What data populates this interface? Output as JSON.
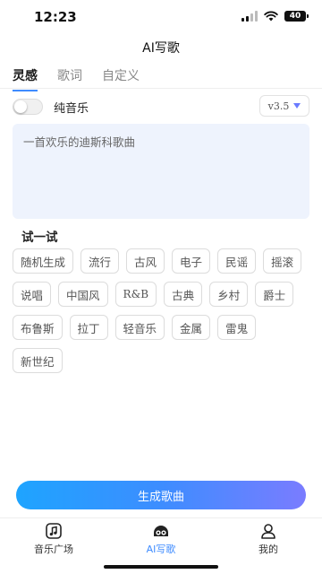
{
  "status": {
    "time": "12:23",
    "battery": "40",
    "icons": [
      "signal-icon",
      "wifi-icon",
      "battery-icon"
    ]
  },
  "header": {
    "title": "AI写歌"
  },
  "tabs": [
    {
      "label": "灵感",
      "active": true
    },
    {
      "label": "歌词",
      "active": false
    },
    {
      "label": "自定义",
      "active": false
    }
  ],
  "options": {
    "pure_music_label": "纯音乐",
    "pure_music_on": false,
    "version": "v3.5"
  },
  "prompt": {
    "placeholder": "一首欢乐的迪斯科歌曲",
    "value": ""
  },
  "suggestions": {
    "title": "试一试",
    "chips": [
      "随机生成",
      "流行",
      "古风",
      "电子",
      "民谣",
      "摇滚",
      "说唱",
      "中国风",
      "R&B",
      "古典",
      "乡村",
      "爵士",
      "布鲁斯",
      "拉丁",
      "轻音乐",
      "金属",
      "雷鬼",
      "新世纪"
    ]
  },
  "generate_label": "生成歌曲",
  "nav": [
    {
      "label": "音乐广场",
      "icon": "music-note-icon",
      "active": false
    },
    {
      "label": "AI写歌",
      "icon": "robot-icon",
      "active": true
    },
    {
      "label": "我的",
      "icon": "person-icon",
      "active": false
    }
  ],
  "colors": {
    "accent": "#3f8cff",
    "prompt_bg": "#eef3fd",
    "button_start": "#1ea4ff",
    "button_end": "#7a7cff"
  }
}
